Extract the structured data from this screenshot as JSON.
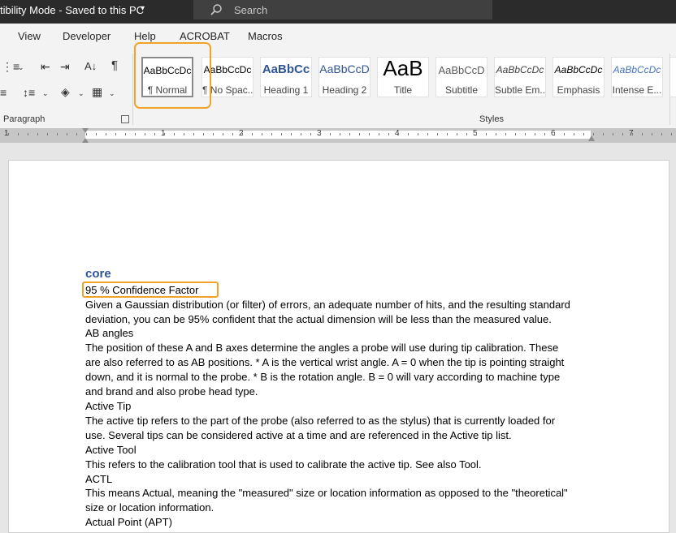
{
  "titlebar": {
    "text": "tibility Mode  -  Saved to this PC",
    "search_placeholder": "Search"
  },
  "menu": [
    "View",
    "Developer",
    "Help",
    "ACROBAT",
    "Macros"
  ],
  "ribbon": {
    "paragraph_label": "Paragraph",
    "styles_label": "Styles",
    "styles": [
      {
        "sample": "AaBbCcDc",
        "name": "¶ Normal"
      },
      {
        "sample": "AaBbCcDc",
        "name": "¶ No Spac..."
      },
      {
        "sample": "AaBbCc",
        "name": "Heading 1"
      },
      {
        "sample": "AaBbCcD",
        "name": "Heading 2"
      },
      {
        "sample": "AaB",
        "name": "Title"
      },
      {
        "sample": "AaBbCcD",
        "name": "Subtitle"
      },
      {
        "sample": "AaBbCcDc",
        "name": "Subtle Em..."
      },
      {
        "sample": "AaBbCcDc",
        "name": "Emphasis"
      },
      {
        "sample": "AaBbCcDc",
        "name": "Intense E..."
      }
    ]
  },
  "ruler": {
    "numbers": [
      "1",
      "1",
      "2",
      "3",
      "4",
      "5",
      "6",
      "7"
    ]
  },
  "document": {
    "heading": "core",
    "lines": [
      "95 % Confidence Factor",
      "Given a Gaussian distribution (or filter) of errors, an adequate number of hits, and the resulting standard",
      "deviation, you can be 95% confident that the actual dimension will be less than the measured value.",
      "AB angles",
      "The position of these A and B axes determine the angles a probe will use during tip calibration. These",
      "are also referred to as AB positions. * A is the vertical wrist angle. A = 0 when the tip is pointing straight",
      "down, and it is normal to the probe. * B is the rotation angle. B = 0 will vary according to machine type",
      "and brand and also probe head type.",
      "Active Tip",
      "The active tip refers to the part of the probe (also referred to as the stylus) that is currently loaded for",
      "use. Several tips can be considered active at a time and are referenced in the Active tip list.",
      "Active Tool",
      "This refers to the calibration tool that is used to calibrate the active tip. See also Tool.",
      "ACTL",
      "This means Actual, meaning the \"measured\" size or location information as opposed to the \"theoretical\"",
      "size or location information.",
      "Actual Point (APT)"
    ]
  }
}
